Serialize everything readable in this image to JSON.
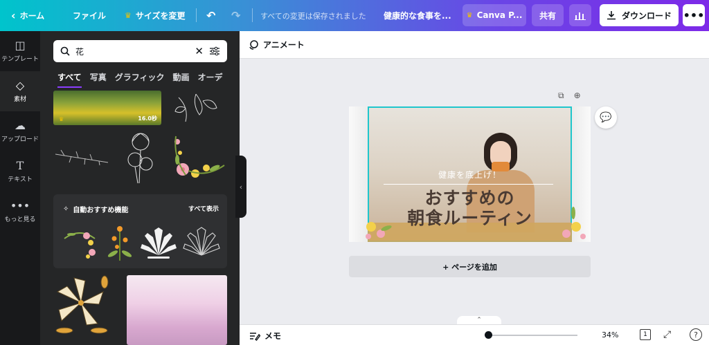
{
  "topbar": {
    "home": "ホーム",
    "file": "ファイル",
    "resize": "サイズを変更",
    "saved_status": "すべての変更は保存されました",
    "design_title": "健康的な食事を...",
    "canva_pro": "Canva P...",
    "share": "共有",
    "download": "ダウンロード"
  },
  "rail": {
    "items": [
      {
        "label": "テンプレート",
        "icon": "template-icon"
      },
      {
        "label": "素材",
        "icon": "elements-icon"
      },
      {
        "label": "アップロード",
        "icon": "upload-icon"
      },
      {
        "label": "テキスト",
        "icon": "text-icon"
      },
      {
        "label": "もっと見る",
        "icon": "more-icon"
      }
    ]
  },
  "panel": {
    "search_value": "花",
    "categories": [
      "すべて",
      "写真",
      "グラフィック",
      "動画",
      "オーデ"
    ],
    "video_duration": "16.0秒",
    "suggest_title": "自動おすすめ機能",
    "suggest_all": "すべて表示"
  },
  "editor": {
    "animate": "アニメート",
    "add_page": "+ ページを追加",
    "design_subtitle": "健康を底上げ！",
    "design_title_line1": "おすすめの",
    "design_title_line2": "朝食ルーティン"
  },
  "footer": {
    "memo": "メモ",
    "zoom": "34%",
    "page_count": "1"
  },
  "colors": {
    "accent_teal": "#00c4cc",
    "accent_purple": "#7d2ae8",
    "selection": "#1ec6cc"
  }
}
